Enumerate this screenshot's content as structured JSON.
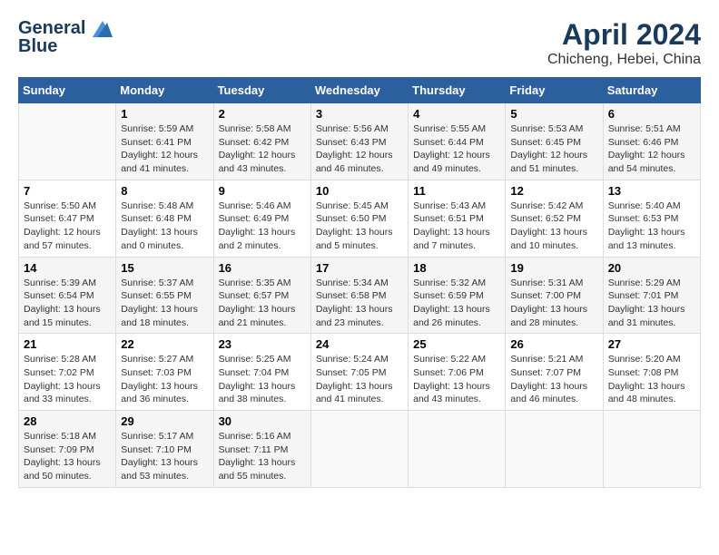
{
  "header": {
    "logo_line1": "General",
    "logo_line2": "Blue",
    "month_year": "April 2024",
    "location": "Chicheng, Hebei, China"
  },
  "days_of_week": [
    "Sunday",
    "Monday",
    "Tuesday",
    "Wednesday",
    "Thursday",
    "Friday",
    "Saturday"
  ],
  "weeks": [
    [
      {
        "num": "",
        "info": ""
      },
      {
        "num": "1",
        "info": "Sunrise: 5:59 AM\nSunset: 6:41 PM\nDaylight: 12 hours\nand 41 minutes."
      },
      {
        "num": "2",
        "info": "Sunrise: 5:58 AM\nSunset: 6:42 PM\nDaylight: 12 hours\nand 43 minutes."
      },
      {
        "num": "3",
        "info": "Sunrise: 5:56 AM\nSunset: 6:43 PM\nDaylight: 12 hours\nand 46 minutes."
      },
      {
        "num": "4",
        "info": "Sunrise: 5:55 AM\nSunset: 6:44 PM\nDaylight: 12 hours\nand 49 minutes."
      },
      {
        "num": "5",
        "info": "Sunrise: 5:53 AM\nSunset: 6:45 PM\nDaylight: 12 hours\nand 51 minutes."
      },
      {
        "num": "6",
        "info": "Sunrise: 5:51 AM\nSunset: 6:46 PM\nDaylight: 12 hours\nand 54 minutes."
      }
    ],
    [
      {
        "num": "7",
        "info": "Sunrise: 5:50 AM\nSunset: 6:47 PM\nDaylight: 12 hours\nand 57 minutes."
      },
      {
        "num": "8",
        "info": "Sunrise: 5:48 AM\nSunset: 6:48 PM\nDaylight: 13 hours\nand 0 minutes."
      },
      {
        "num": "9",
        "info": "Sunrise: 5:46 AM\nSunset: 6:49 PM\nDaylight: 13 hours\nand 2 minutes."
      },
      {
        "num": "10",
        "info": "Sunrise: 5:45 AM\nSunset: 6:50 PM\nDaylight: 13 hours\nand 5 minutes."
      },
      {
        "num": "11",
        "info": "Sunrise: 5:43 AM\nSunset: 6:51 PM\nDaylight: 13 hours\nand 7 minutes."
      },
      {
        "num": "12",
        "info": "Sunrise: 5:42 AM\nSunset: 6:52 PM\nDaylight: 13 hours\nand 10 minutes."
      },
      {
        "num": "13",
        "info": "Sunrise: 5:40 AM\nSunset: 6:53 PM\nDaylight: 13 hours\nand 13 minutes."
      }
    ],
    [
      {
        "num": "14",
        "info": "Sunrise: 5:39 AM\nSunset: 6:54 PM\nDaylight: 13 hours\nand 15 minutes."
      },
      {
        "num": "15",
        "info": "Sunrise: 5:37 AM\nSunset: 6:55 PM\nDaylight: 13 hours\nand 18 minutes."
      },
      {
        "num": "16",
        "info": "Sunrise: 5:35 AM\nSunset: 6:57 PM\nDaylight: 13 hours\nand 21 minutes."
      },
      {
        "num": "17",
        "info": "Sunrise: 5:34 AM\nSunset: 6:58 PM\nDaylight: 13 hours\nand 23 minutes."
      },
      {
        "num": "18",
        "info": "Sunrise: 5:32 AM\nSunset: 6:59 PM\nDaylight: 13 hours\nand 26 minutes."
      },
      {
        "num": "19",
        "info": "Sunrise: 5:31 AM\nSunset: 7:00 PM\nDaylight: 13 hours\nand 28 minutes."
      },
      {
        "num": "20",
        "info": "Sunrise: 5:29 AM\nSunset: 7:01 PM\nDaylight: 13 hours\nand 31 minutes."
      }
    ],
    [
      {
        "num": "21",
        "info": "Sunrise: 5:28 AM\nSunset: 7:02 PM\nDaylight: 13 hours\nand 33 minutes."
      },
      {
        "num": "22",
        "info": "Sunrise: 5:27 AM\nSunset: 7:03 PM\nDaylight: 13 hours\nand 36 minutes."
      },
      {
        "num": "23",
        "info": "Sunrise: 5:25 AM\nSunset: 7:04 PM\nDaylight: 13 hours\nand 38 minutes."
      },
      {
        "num": "24",
        "info": "Sunrise: 5:24 AM\nSunset: 7:05 PM\nDaylight: 13 hours\nand 41 minutes."
      },
      {
        "num": "25",
        "info": "Sunrise: 5:22 AM\nSunset: 7:06 PM\nDaylight: 13 hours\nand 43 minutes."
      },
      {
        "num": "26",
        "info": "Sunrise: 5:21 AM\nSunset: 7:07 PM\nDaylight: 13 hours\nand 46 minutes."
      },
      {
        "num": "27",
        "info": "Sunrise: 5:20 AM\nSunset: 7:08 PM\nDaylight: 13 hours\nand 48 minutes."
      }
    ],
    [
      {
        "num": "28",
        "info": "Sunrise: 5:18 AM\nSunset: 7:09 PM\nDaylight: 13 hours\nand 50 minutes."
      },
      {
        "num": "29",
        "info": "Sunrise: 5:17 AM\nSunset: 7:10 PM\nDaylight: 13 hours\nand 53 minutes."
      },
      {
        "num": "30",
        "info": "Sunrise: 5:16 AM\nSunset: 7:11 PM\nDaylight: 13 hours\nand 55 minutes."
      },
      {
        "num": "",
        "info": ""
      },
      {
        "num": "",
        "info": ""
      },
      {
        "num": "",
        "info": ""
      },
      {
        "num": "",
        "info": ""
      }
    ]
  ]
}
